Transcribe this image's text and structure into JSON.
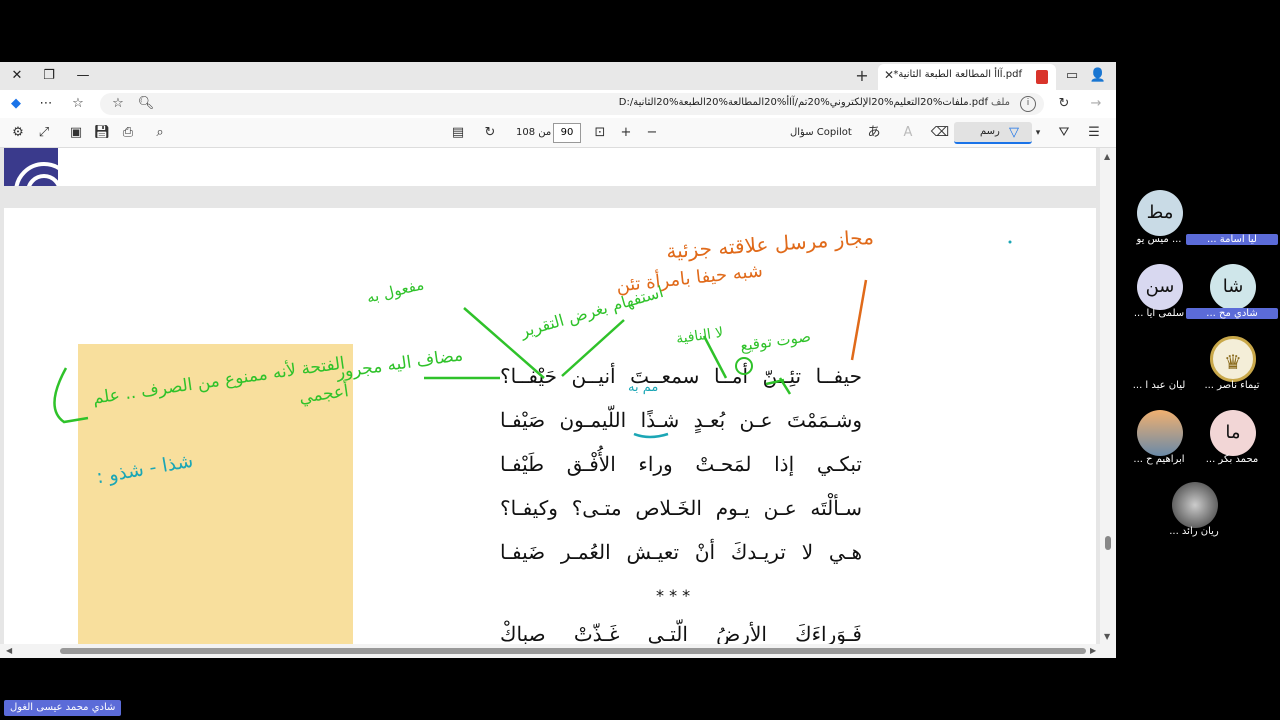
{
  "browser": {
    "tab_title": "*آاأ المطالعة الطبعة الثانية.pdf",
    "address_url": "D:/ملفات%20التعليم%20الإلكتروني%20تم/آاأ%20المطالعة%20الطبعة%20الثانية.pdf",
    "address_label": "ملف"
  },
  "pdf_toolbar": {
    "page_current": "90",
    "page_of": "من 108",
    "copilot_label": "سؤال Copilot",
    "draw_label": "رسم"
  },
  "poem": {
    "lines": [
      "حيفــا تئِــنّ أمــا سمعــتَ أنيــن حَيْفــا؟",
      "وشـمَمْتَ عـن بُعـدٍ شـذًا اللّيمـون صَيْفـا",
      "تبكـي إذا لمَحـتْ وراء الأُفْـق طَيْفـا",
      "سـألْتَه عـن يـوم الخَـلاص متـى؟ وكيفـا؟",
      "هـي لا تريـدكَ أنْ تعيـش العُمـر ضَيفـا"
    ],
    "stars": "* * *",
    "next_line": "فَـوَراءَكَ الأرضُ الّتـي غَـذّتْ صباكْ"
  },
  "annotations": {
    "orange_1": "مجاز مرسل علاقته جزئية",
    "orange_2": "شبه حيفا بامرأة تئن",
    "green_1": "مفعول به",
    "green_2": "استفهام بغرض التقرير",
    "green_3": "لا النافية",
    "green_4": "صوت توقيع",
    "green_5": "مضاف اليه مجرور",
    "green_6": "الفتحة لأنه ممنوع من الصرف .. علم أعجمي",
    "teal_1": "مم به",
    "teal_2": "شذا - شذو :"
  },
  "participants": [
    {
      "initials": "مط",
      "name": "... ميس يو",
      "color": "#c9dbe6"
    },
    {
      "initials": "",
      "name": "ليا اسامة ...",
      "color": "#000000",
      "tag": true
    },
    {
      "initials": "سن",
      "name": "سلمى ايا ...",
      "color": "#d8d8f0"
    },
    {
      "initials": "شا",
      "name": "شادي مح ...",
      "color": "#cfe6ea",
      "tag": true
    },
    {
      "initials": "",
      "name": "ليان عبد ا ...",
      "color": "#000000"
    },
    {
      "initials": "",
      "name": "تيماء ناصر ...",
      "color": "#f4eed8"
    },
    {
      "initials": "",
      "name": "ابراهيم ح ...",
      "color": "#e09a5a"
    },
    {
      "initials": "ما",
      "name": "محمد بكر ...",
      "color": "#f2d6d6"
    },
    {
      "initials": "",
      "name": "ريان رائد ...",
      "color": "#555555"
    }
  ],
  "presenter": {
    "name": "شادي محمد عيسى الغول"
  }
}
